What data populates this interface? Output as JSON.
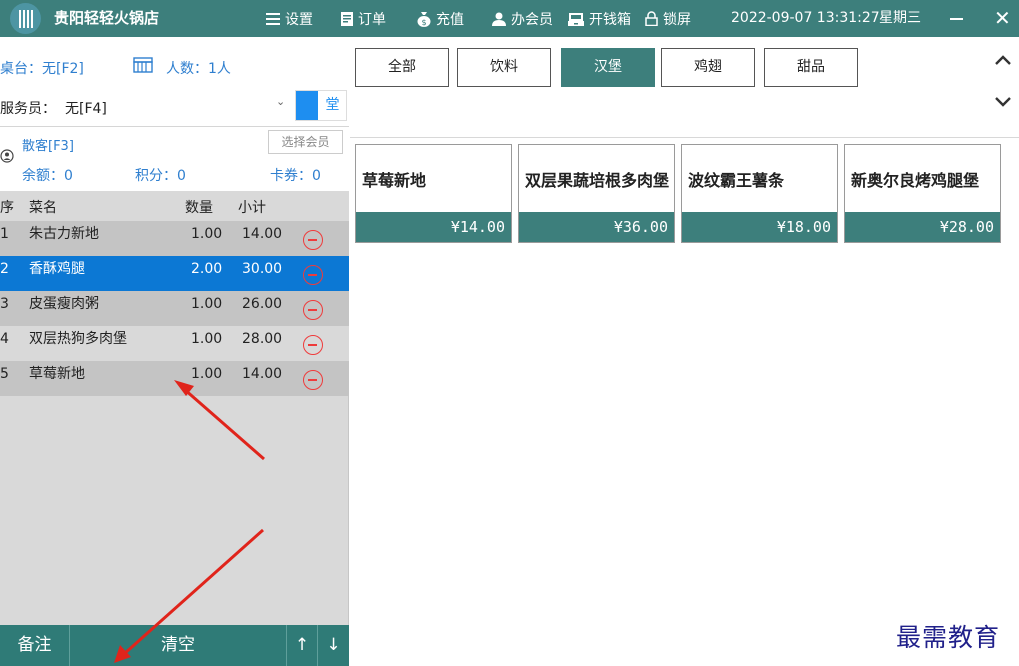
{
  "app": {
    "title": "贵阳轻轻火锅店",
    "logo_icon": "fork-knife-icon",
    "accent_color": "#3d7f7c"
  },
  "toolbar": {
    "settings_label": "设置",
    "orders_label": "订单",
    "recharge_label": "充值",
    "membership_label": "办会员",
    "cash_drawer_label": "开钱箱",
    "lock_label": "锁屏",
    "datetime": "2022-09-07 13:31:27",
    "weekday": "星期三",
    "close_glyph": "✕"
  },
  "order_info": {
    "table": "桌台：无[F2]",
    "people": "人数：1人",
    "waiter_label": "服务员：",
    "waiter_value": "无[F4]",
    "dine_mode": "堂",
    "customer": "散客[F3]",
    "select_member_label": "选择会员",
    "balance": "余额：0",
    "points": "积分：0",
    "coupons": "卡券：0"
  },
  "order_table": {
    "columns": [
      "序",
      "菜名",
      "数量",
      "小计"
    ],
    "rows": [
      {
        "no": "1",
        "name": "朱古力新地",
        "qty": "1.00",
        "subtotal": "14.00"
      },
      {
        "no": "2",
        "name": "香酥鸡腿",
        "qty": "2.00",
        "subtotal": "30.00"
      },
      {
        "no": "3",
        "name": "皮蛋瘦肉粥",
        "qty": "1.00",
        "subtotal": "26.00"
      },
      {
        "no": "4",
        "name": "双层热狗多肉堡",
        "qty": "1.00",
        "subtotal": "28.00"
      },
      {
        "no": "5",
        "name": "草莓新地",
        "qty": "1.00",
        "subtotal": "14.00"
      }
    ],
    "selected_row": 2
  },
  "bottom_bar": {
    "remark_label": "备注",
    "clear_label": "清空",
    "up_label": "↑",
    "down_label": "↓"
  },
  "categories": [
    {
      "label": "全部",
      "active": false
    },
    {
      "label": "饮料",
      "active": false
    },
    {
      "label": "汉堡",
      "active": true
    },
    {
      "label": "鸡翅",
      "active": false
    },
    {
      "label": "甜品",
      "active": false
    }
  ],
  "products": [
    {
      "name": "草莓新地",
      "price": "¥14.00"
    },
    {
      "name": "双层果蔬培根多肉堡",
      "price": "¥36.00"
    },
    {
      "name": "波纹霸王薯条",
      "price": "¥18.00"
    },
    {
      "name": "新奥尔良烤鸡腿堡",
      "price": "¥28.00"
    }
  ],
  "watermark": "最需教育",
  "annotation_color": "#e0241b"
}
